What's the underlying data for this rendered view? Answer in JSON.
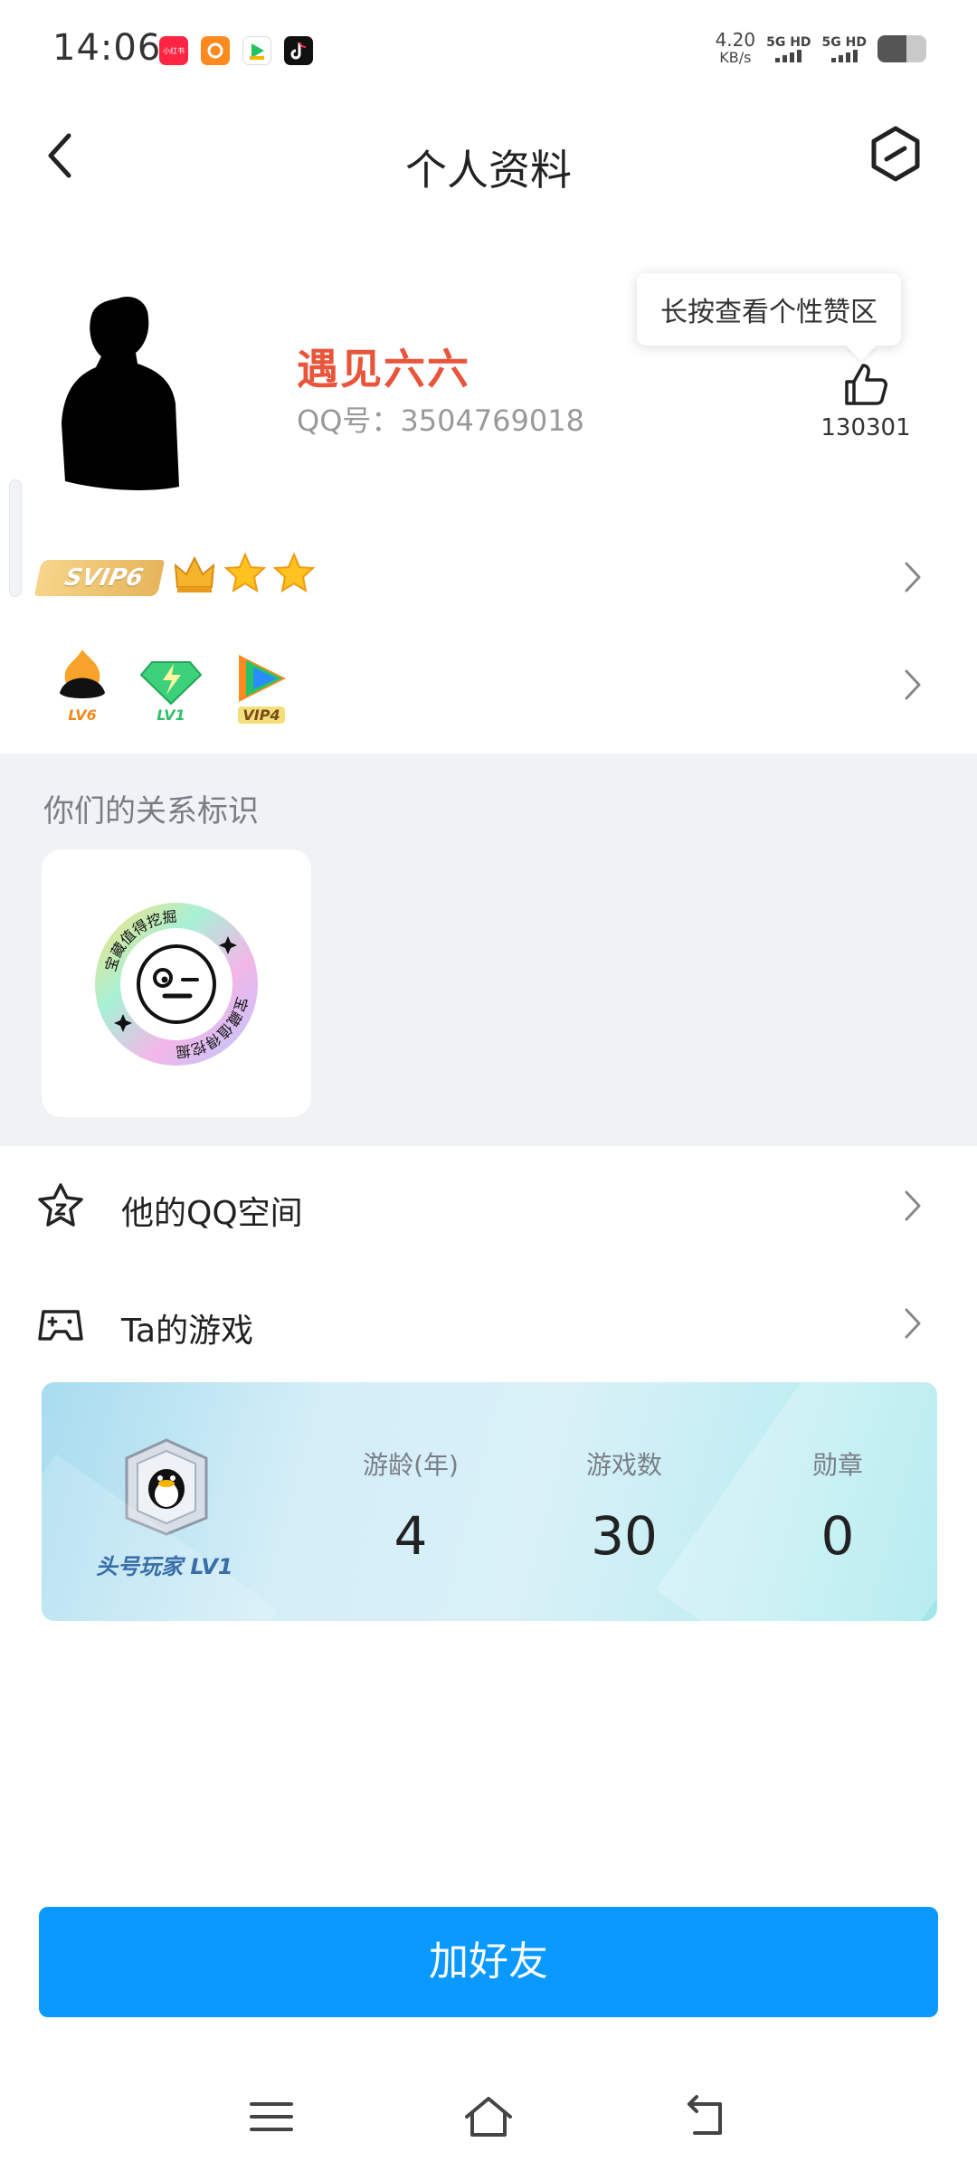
{
  "status_bar": {
    "time": "14:06",
    "net_speed_value": "4.20",
    "net_speed_unit": "KB/s",
    "signal_1": "5G HD",
    "signal_2": "5G HD",
    "battery_level": 0.6,
    "app_icons": [
      "xiaohongshu-icon",
      "app-orange-icon",
      "app-green-icon",
      "tiktok-icon"
    ],
    "xiaohongshu_text": "小红书"
  },
  "header": {
    "title": "个人资料"
  },
  "profile": {
    "name": "遇见六六",
    "qq_number": "QQ号：3504769018",
    "tooltip": "长按查看个性赞区",
    "like_count": "130301"
  },
  "badges": {
    "svip": "SVIP6",
    "levels": [
      {
        "text": "LV6",
        "color": "#f08a1c"
      },
      {
        "text": "LV1",
        "color": "#2fbf6a"
      },
      {
        "text": "VIP4",
        "color": "#7a4b1a"
      }
    ]
  },
  "relation": {
    "title": "你们的关系标识",
    "emblem_text": "宝藏值得挖掘"
  },
  "list": {
    "qzone_label": "他的QQ空间",
    "games_label": "Ta的游戏"
  },
  "game_card": {
    "player_level": "头号玩家 LV1",
    "stats": [
      {
        "label": "游龄(年)",
        "value": "4"
      },
      {
        "label": "游戏数",
        "value": "30"
      },
      {
        "label": "勋章",
        "value": "0"
      }
    ]
  },
  "actions": {
    "add_friend_label": "加好友"
  },
  "colors": {
    "accent": "#0a99ff",
    "name": "#e8553b",
    "section_bg": "#f1f2f5"
  }
}
